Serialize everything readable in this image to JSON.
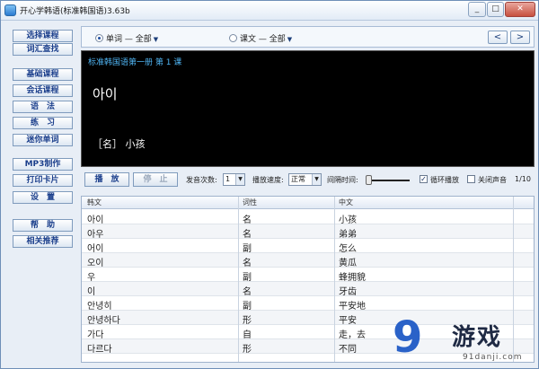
{
  "window": {
    "title": "开心学韩语(标准韩国语)3.63b",
    "buttons": {
      "minimize": "_",
      "maximize": "□",
      "close": "✕"
    }
  },
  "sidebar": {
    "items": [
      {
        "label": "选择课程"
      },
      {
        "label": "词汇查找"
      },
      {
        "label": "基础课程"
      },
      {
        "label": "会话课程"
      },
      {
        "label": "语　法"
      },
      {
        "label": "练　习"
      },
      {
        "label": "迷你单词"
      },
      {
        "label": "MP3制作"
      },
      {
        "label": "打印卡片"
      },
      {
        "label": "设　置"
      },
      {
        "label": "帮　助"
      },
      {
        "label": "相关推荐"
      }
    ]
  },
  "mode": {
    "word_label": "单词 — 全部",
    "text_label": "课文 — 全部",
    "prev": "<",
    "next": ">"
  },
  "display": {
    "header": "标准韩国语第一册 第 1 课",
    "word": "아이",
    "meaning": "［名］ 小孩"
  },
  "controls": {
    "play": "播　放",
    "stop": "停　止",
    "repeat_label": "发音次数:",
    "repeat_value": "1",
    "speed_label": "播放速度:",
    "speed_value": "正常",
    "interval_label": "间隔时间:",
    "interval_fraction": 0.05,
    "loop_label": "循环播放",
    "loop_checked": true,
    "mute_label": "关闭声音",
    "mute_checked": false,
    "counter": "1/10"
  },
  "table": {
    "headers": [
      "韩文",
      "词性",
      "中文"
    ],
    "rows": [
      {
        "korean": "아이",
        "pos": "名",
        "chinese": "小孩"
      },
      {
        "korean": "아우",
        "pos": "名",
        "chinese": "弟弟"
      },
      {
        "korean": "어이",
        "pos": "副",
        "chinese": "怎么"
      },
      {
        "korean": "오이",
        "pos": "名",
        "chinese": "黄瓜"
      },
      {
        "korean": "우",
        "pos": "副",
        "chinese": "蜂拥貌"
      },
      {
        "korean": "이",
        "pos": "名",
        "chinese": "牙齿"
      },
      {
        "korean": "안녕히",
        "pos": "副",
        "chinese": "平安地"
      },
      {
        "korean": "안녕하다",
        "pos": "形",
        "chinese": "平安"
      },
      {
        "korean": "가다",
        "pos": "自",
        "chinese": "走，去"
      },
      {
        "korean": "다르다",
        "pos": "形",
        "chinese": "不同"
      }
    ]
  },
  "watermark": {
    "logo": "9",
    "brand": "游戏",
    "url": "91danji.com"
  },
  "colors": {
    "accent": "#1b3f8c",
    "display_bg": "#000000",
    "display_header": "#4fb4f2"
  }
}
